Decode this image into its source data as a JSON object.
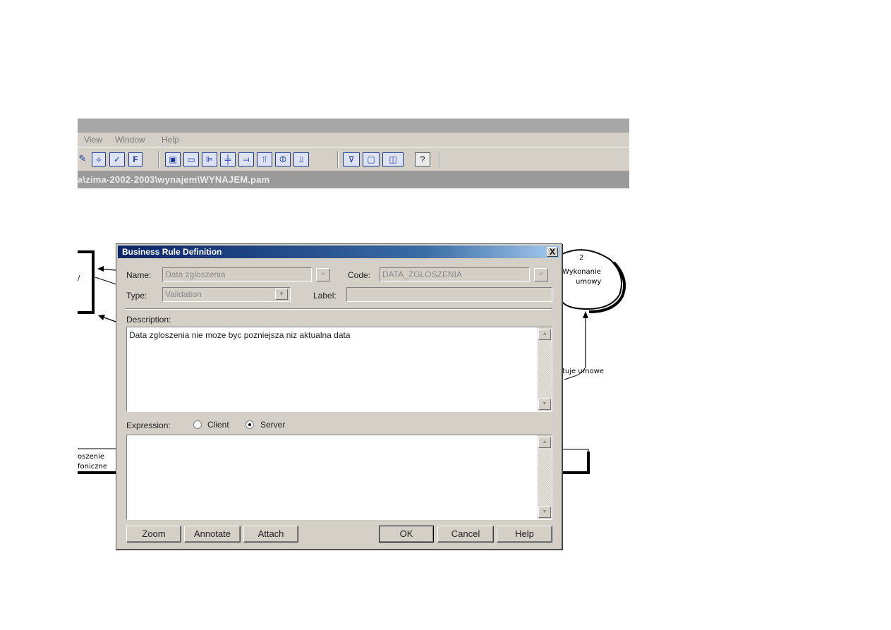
{
  "menubar": {
    "items": [
      "View",
      "Window",
      "Help"
    ]
  },
  "toolbar": {
    "icons": [
      "pencil-icon",
      "paint-icon",
      "text-style-icon",
      "font-icon",
      "text-tool-icon",
      "rectangle-icon",
      "align-left-icon",
      "align-center-icon",
      "align-right-icon",
      "align-top-icon",
      "align-middle-icon",
      "align-bottom-icon",
      "filter-icon",
      "window-icon",
      "split-window-icon",
      "help-icon"
    ],
    "font_label": "F",
    "help_label": "?"
  },
  "pathbar": {
    "text": "a\\zima-2002-2003\\wynajem\\WYNAJEM.pam"
  },
  "diagram": {
    "process_number": "2",
    "process_name_line1": "Wykonanie",
    "process_name_line2": "umowy",
    "flow_label": "tuje umowe",
    "left_label_line1": "oszenie",
    "left_label_line2": "foniczne"
  },
  "dialog": {
    "title": "Business Rule Definition",
    "close_label": "X",
    "name_label": "Name:",
    "name_value": "Data zgloszenia",
    "name_button": "=",
    "code_label": "Code:",
    "code_value": "DATA_ZGLOSZENIA",
    "code_button": "=",
    "type_label": "Type:",
    "type_value": "Validation",
    "label_label": "Label:",
    "label_value": "",
    "description_label": "Description:",
    "description_value": "Data zgloszenia nie moze byc pozniejsza niz aktualna data",
    "expression_label": "Expression:",
    "expression_options": [
      {
        "label": "Client",
        "selected": false
      },
      {
        "label": "Server",
        "selected": true
      }
    ],
    "expression_value": "",
    "buttons": {
      "zoom": "Zoom",
      "annotate": "Annotate",
      "attach": "Attach",
      "ok": "OK",
      "cancel": "Cancel",
      "help": "Help"
    }
  },
  "colors": {
    "titlebar_start": "#0a246a",
    "titlebar_end": "#a6caf0",
    "dialog_face": "#d4d0c8",
    "toolbar_icon": "#1a3aa0"
  }
}
